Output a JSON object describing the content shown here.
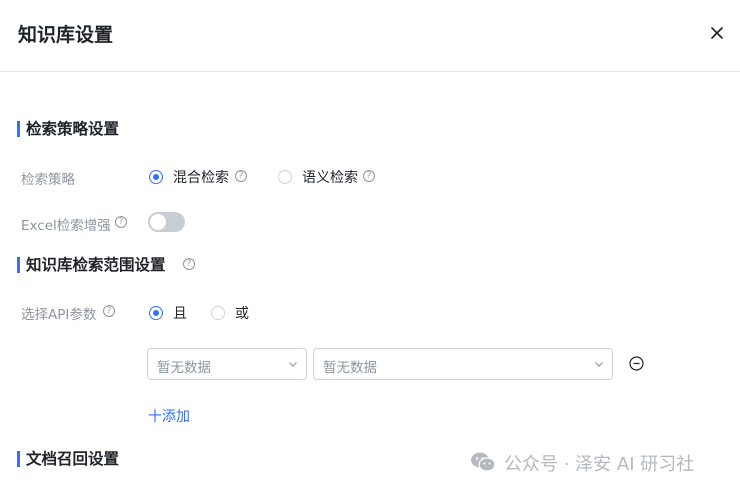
{
  "dialog": {
    "title": "知识库设置"
  },
  "search_settings": {
    "section_title": "检索策略设置",
    "strategy": {
      "label": "检索策略",
      "options": [
        {
          "label": "混合检索",
          "checked": true
        },
        {
          "label": "语义检索",
          "checked": false
        }
      ]
    },
    "excel_enhance": {
      "label": "Excel检索增强",
      "enabled": false
    }
  },
  "scope_settings": {
    "section_title": "知识库检索范围设置",
    "api_params": {
      "label": "选择API参数",
      "options": [
        {
          "label": "且",
          "checked": true
        },
        {
          "label": "或",
          "checked": false
        }
      ]
    },
    "condition_row": {
      "field_placeholder": "暂无数据",
      "value_placeholder": "暂无数据"
    },
    "add_label": "十添加"
  },
  "recall_settings": {
    "section_title": "文档召回设置"
  },
  "watermark": "公众号 · 泽安 AI 研习社",
  "colors": {
    "accent": "#3370ff",
    "muted": "#8f959e",
    "text": "#1f2329",
    "border": "#d0d3d6"
  }
}
